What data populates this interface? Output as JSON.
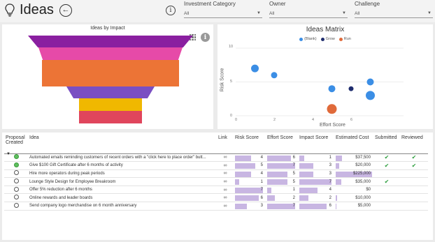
{
  "header": {
    "title": "Ideas",
    "filters": [
      {
        "label": "Investment Category",
        "value": "All"
      },
      {
        "label": "Owner",
        "value": "All"
      },
      {
        "label": "Challenge",
        "value": "All"
      }
    ]
  },
  "funnel": {
    "title": "Ideas by Impact",
    "bar_colors": [
      "#8a1fa0",
      "#e64aa8",
      "#ec7436",
      "#7a4fc2",
      "#f0b800",
      "#e0455c"
    ]
  },
  "matrix": {
    "title": "Ideas Matrix",
    "xlabel": "Effort Score",
    "ylabel": "Risk Score",
    "legend": [
      {
        "label": "(Blank)",
        "color": "#3b8ee5"
      },
      {
        "label": "Grow",
        "color": "#1f2d6e"
      },
      {
        "label": "Run",
        "color": "#e06a3a"
      }
    ],
    "xticks": [
      "0",
      "2",
      "4",
      "6"
    ],
    "yticks": [
      "10",
      "5",
      "0"
    ]
  },
  "chart_data": {
    "type": "scatter",
    "title": "Ideas Matrix",
    "xlabel": "Effort Score",
    "ylabel": "Risk Score",
    "xlim": [
      0,
      8
    ],
    "ylim": [
      0,
      10
    ],
    "series": [
      {
        "name": "(Blank)",
        "points": [
          [
            1,
            7
          ],
          [
            2,
            6
          ],
          [
            5,
            4
          ],
          [
            7,
            5
          ],
          [
            7,
            3
          ]
        ]
      },
      {
        "name": "Grow",
        "points": [
          [
            6,
            4
          ]
        ]
      },
      {
        "name": "Run",
        "points": [
          [
            5,
            1
          ]
        ]
      }
    ]
  },
  "table": {
    "headers": [
      "Proposal Created",
      "Idea",
      "Link",
      "Risk Score",
      "Effort Score",
      "Impact Score",
      "Estimated Cost",
      "Submitted",
      "Reviewed"
    ],
    "rows": [
      {
        "done": true,
        "idea": "Automated emails reminding customers of recent orders with a \"click here to place order\" butt...",
        "risk": "4",
        "effort": "6",
        "impact": "1",
        "cost": "$37,500",
        "submitted": "✔",
        "reviewed": "✔"
      },
      {
        "done": true,
        "idea": "Give $100 Gift Certificate after 6 months of activity",
        "risk": "5",
        "effort": "7",
        "impact": "3",
        "cost": "$20,000",
        "submitted": "✔",
        "reviewed": "✔"
      },
      {
        "done": false,
        "idea": "Hire more operators during peak periods",
        "risk": "4",
        "effort": "5",
        "impact": "3",
        "cost": "$225,000",
        "submitted": "",
        "reviewed": ""
      },
      {
        "done": false,
        "idea": "Lounge Style Design for Employee Breakroom",
        "risk": "1",
        "effort": "5",
        "impact": "7",
        "cost": "$35,000",
        "submitted": "✔",
        "reviewed": ""
      },
      {
        "done": false,
        "idea": "Offer 5% reduction after 6 months",
        "risk": "7",
        "effort": "1",
        "impact": "4",
        "cost": "$0",
        "submitted": "",
        "reviewed": ""
      },
      {
        "done": false,
        "idea": "Online rewards and leader boards",
        "risk": "6",
        "effort": "2",
        "impact": "2",
        "cost": "$10,000",
        "submitted": "",
        "reviewed": ""
      },
      {
        "done": false,
        "idea": "Send company logo merchandise on 6 month anniversary",
        "risk": "3",
        "effort": "7",
        "impact": "6",
        "cost": "$5,000",
        "submitted": "",
        "reviewed": ""
      }
    ]
  }
}
